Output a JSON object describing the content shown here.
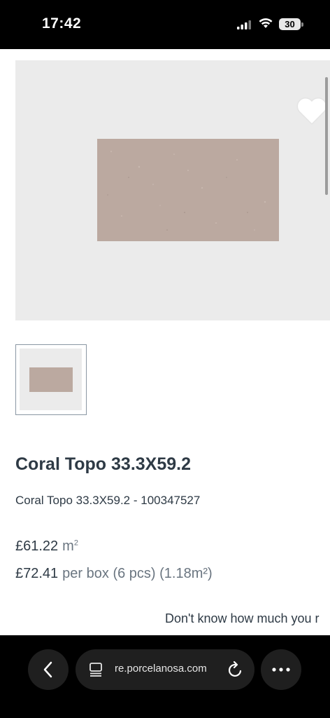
{
  "status_bar": {
    "time": "17:42",
    "battery": "30"
  },
  "product": {
    "title": "Coral Topo 33.3X59.2",
    "code_line": "Coral Topo 33.3X59.2 - 100347527",
    "price_per_m2": "£61.22",
    "price_per_m2_unit": "m",
    "price_per_m2_unit_sup": "2",
    "price_per_box": "£72.41",
    "price_per_box_unit": "per box (6 pcs) (1.18m²)",
    "calculator_prompt": "Don't know how much you r",
    "tile_color": "#bba9a0"
  },
  "browser": {
    "url": "re.porcelanosa.com"
  },
  "colors": {
    "text": "#2e3a45",
    "muted": "#6a7580",
    "image_bg": "#ebebeb"
  }
}
